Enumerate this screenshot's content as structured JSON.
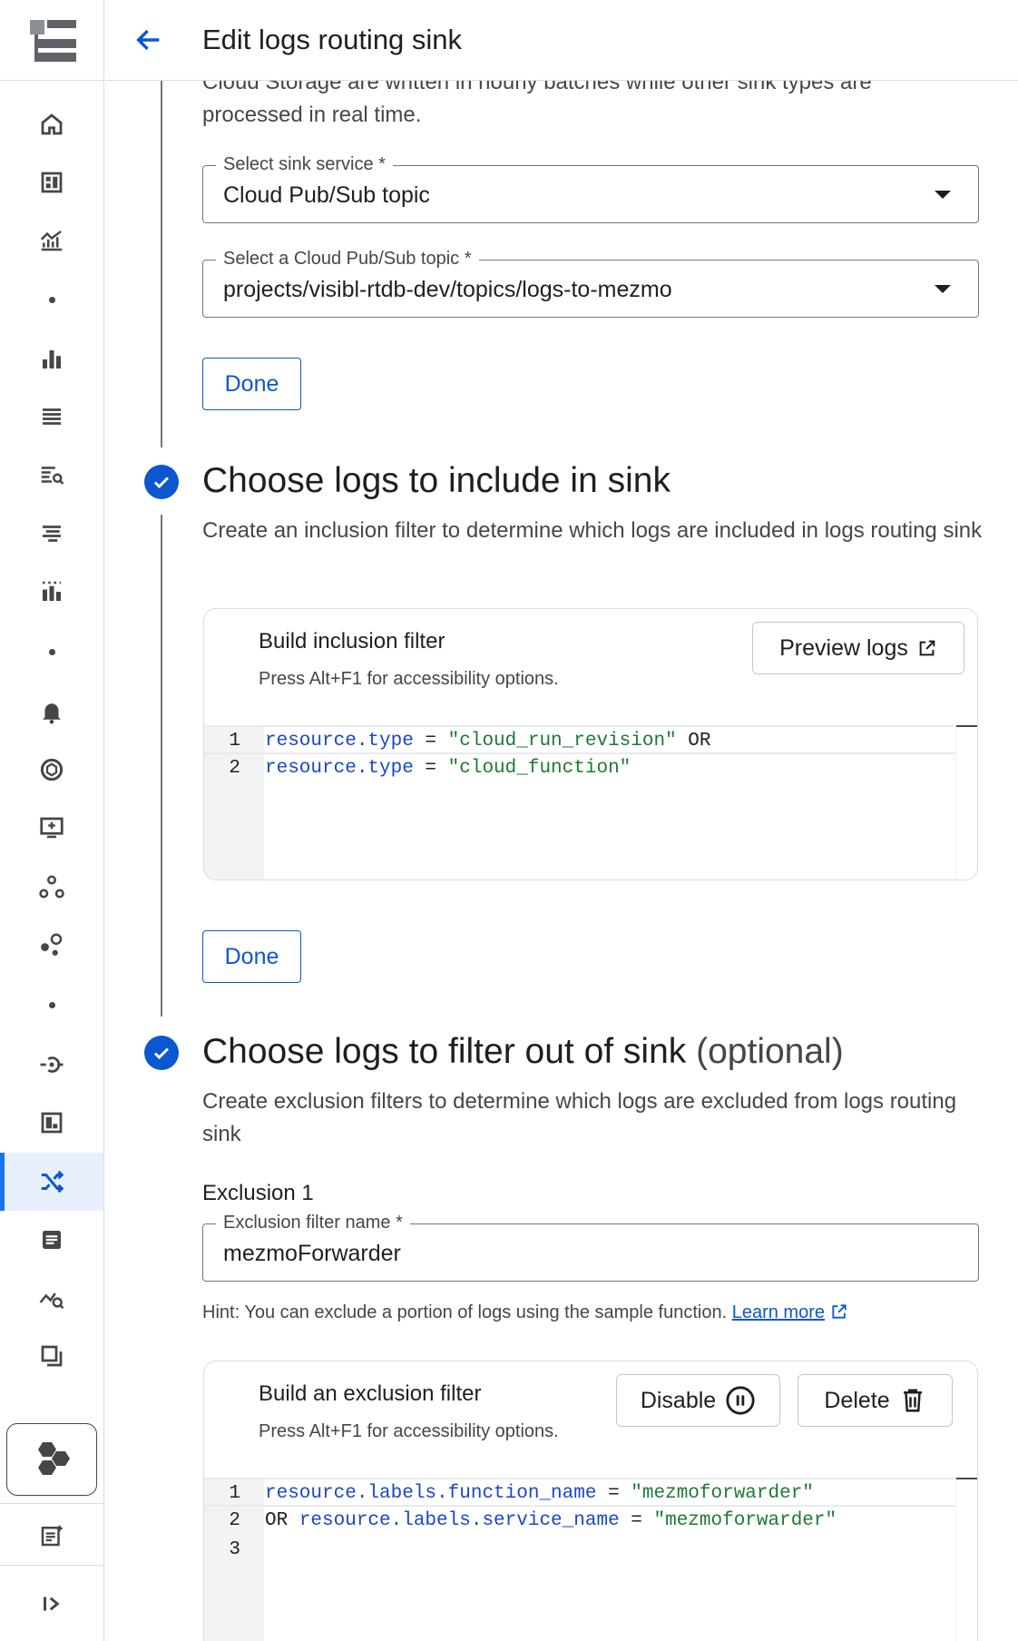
{
  "header": {
    "title": "Edit logs routing sink"
  },
  "rail": {
    "items": [
      "home-icon",
      "dashboard-icon",
      "metrics-icon",
      "charts-icon",
      "logs-list-icon",
      "log-search-icon",
      "filter-lines-icon",
      "grid-chart-icon",
      "bell-icon",
      "security-icon",
      "monitor-icon",
      "nodes-icon",
      "graph-icon",
      "api-icon",
      "panel-icon",
      "log-router-icon",
      "document-icon",
      "analytics-icon",
      "copy-icon",
      "hex-cluster-icon",
      "notes-icon",
      "expand-icon"
    ]
  },
  "destination": {
    "cut_text_line1": "Cloud Storage are written in hourly batches while other sink types are",
    "cut_text_line2": "processed in real time.",
    "service_label": "Select sink service *",
    "service_value": "Cloud Pub/Sub topic",
    "topic_label": "Select a Cloud Pub/Sub topic *",
    "topic_value": "projects/visibl-rtdb-dev/topics/logs-to-mezmo",
    "done_label": "Done"
  },
  "inclusion": {
    "title": "Choose logs to include in sink",
    "description": "Create an inclusion filter to determine which logs are included in logs routing sink",
    "card_title": "Build inclusion filter",
    "card_hint": "Press Alt+F1 for accessibility options.",
    "preview_label": "Preview logs",
    "code": [
      {
        "num": "1",
        "field": "resource.type",
        "op": " = ",
        "value": "\"cloud_run_revision\"",
        "tail": " OR"
      },
      {
        "num": "2",
        "field": "resource.type",
        "op": " = ",
        "value": "\"cloud_function\"",
        "tail": ""
      }
    ],
    "done_label": "Done"
  },
  "exclusion": {
    "title": "Choose logs to filter out of sink",
    "optional": "(optional)",
    "description": "Create exclusion filters to determine which logs are excluded from logs routing sink",
    "section_label": "Exclusion 1",
    "name_label": "Exclusion filter name *",
    "name_value": "mezmoForwarder",
    "hint_text": "Hint: You can exclude a portion of logs using the sample function.",
    "learn_more": "Learn more",
    "card_title": "Build an exclusion filter",
    "card_hint": "Press Alt+F1 for accessibility options.",
    "disable_label": "Disable",
    "delete_label": "Delete",
    "code": [
      {
        "num": "1",
        "prefix": "",
        "field": "resource.labels.function_name",
        "op": " = ",
        "value": "\"mezmoforwarder\""
      },
      {
        "num": "2",
        "prefix": "OR ",
        "field": "resource.labels.service_name",
        "op": " = ",
        "value": "\"mezmoforwarder\""
      },
      {
        "num": "3",
        "prefix": "",
        "field": "",
        "op": "",
        "value": ""
      }
    ]
  },
  "colors": {
    "accent": "#0b57d0",
    "rail_active": "#e8f0fe",
    "code_keyword": "#1a47c8",
    "code_string": "#1d7a33"
  }
}
